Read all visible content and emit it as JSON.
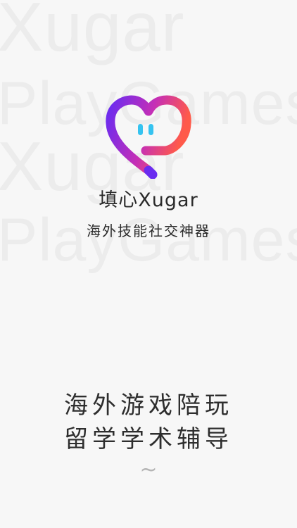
{
  "watermark": {
    "line1": "Xugar",
    "line2": "PlayGames",
    "line3": "Xugar",
    "line4": "PlayGames"
  },
  "app": {
    "name": "填心Xugar",
    "subtitle": "海外技能社交神器"
  },
  "taglines": {
    "line1": "海外游戏陪玩",
    "line2": "留学学术辅导"
  },
  "indicator": "~",
  "colors": {
    "background": "#f7f7f7",
    "logo_gradient_start": "#6a2cf0",
    "logo_gradient_mid": "#c52fb6",
    "logo_gradient_end": "#ff5a4a",
    "logo_eyes": "#35c3f0",
    "text_dark": "#2b2b2b",
    "watermark": "#ececec"
  }
}
